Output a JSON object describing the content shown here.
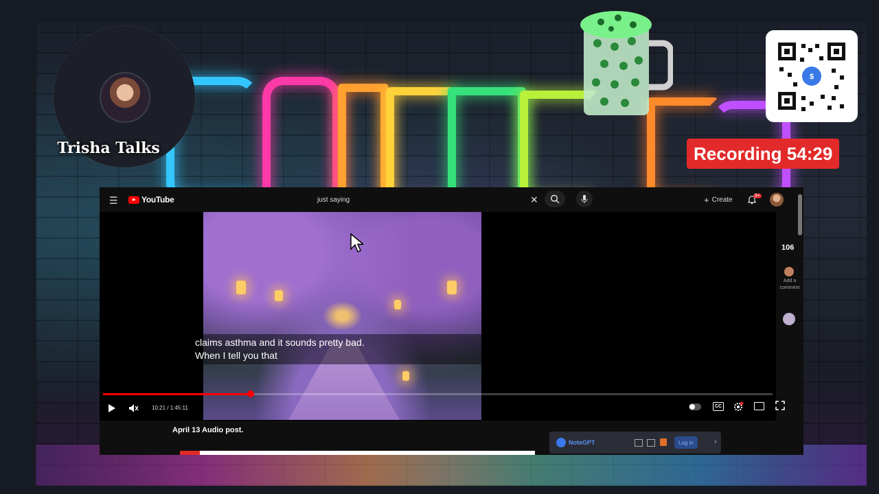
{
  "overlay": {
    "host_name": "Trisha Talks",
    "recording_label": "Recording 54:29",
    "colors": {
      "recording_bg": "#e32a2a",
      "accent": "#ff0000"
    }
  },
  "youtube": {
    "logo_text": "YouTube",
    "search_query": "just saying",
    "create_label": "Create",
    "notification_count": "9+",
    "player": {
      "caption_line1": "claims asthma and it sounds pretty bad.",
      "caption_line2": "When I tell you that",
      "time_display": "10:21 / 1:45:11",
      "progress_fraction": 0.22
    },
    "side": {
      "count": "106",
      "add_comment": "Add a comment"
    },
    "post_title": "April 13 Audio post.",
    "notegpt": {
      "label": "NoteGPT",
      "login_label": "Log in"
    }
  },
  "icons": [
    "menu-icon",
    "close-icon",
    "search-icon",
    "mic-icon",
    "plus-icon",
    "bell-icon",
    "play-icon",
    "volume-icon",
    "autoplay-icon",
    "captions-icon",
    "settings-icon",
    "miniplayer-icon",
    "fullscreen-icon",
    "mouse-pointer-icon"
  ]
}
